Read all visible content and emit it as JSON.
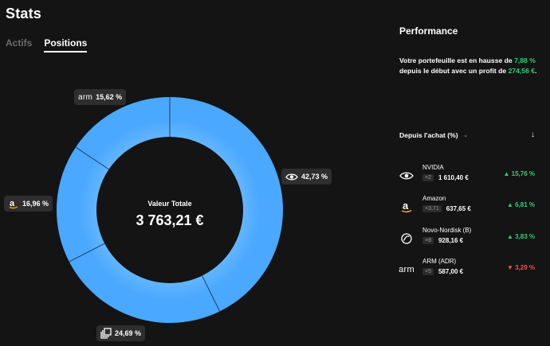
{
  "header": {
    "title": "Stats"
  },
  "tabs": [
    {
      "label": "Actifs",
      "active": false
    },
    {
      "label": "Positions",
      "active": true
    }
  ],
  "donut": {
    "center_label": "Valeur Totale",
    "center_value": "3 763,21 €",
    "segment_color": "#4aa8ff",
    "segments": [
      {
        "name": "NVIDIA",
        "value": 42.73,
        "label": "42,73 %",
        "icon": "nvidia-logo-icon"
      },
      {
        "name": "Novo-Nordisk",
        "value": 24.69,
        "label": "24,69 %",
        "icon": "stack-icon"
      },
      {
        "name": "Amazon",
        "value": 16.96,
        "label": "16,96 %",
        "icon": "amazon-logo-icon"
      },
      {
        "name": "ARM",
        "value": 15.62,
        "label": "15,62 %",
        "icon": "arm-logo-icon",
        "logo_text": "arm"
      }
    ]
  },
  "performance": {
    "title": "Performance",
    "text_before": "Votre portefeuille est en hausse de ",
    "percent": "7,88 %",
    "text_middle": " depuis le début avec un profit de ",
    "profit": "274,56 €",
    "text_after": "."
  },
  "sort": {
    "label": "Depuis l'achat (%)",
    "chevron": "⌄",
    "arrow": "↓"
  },
  "positions": [
    {
      "name": "NVIDIA",
      "qty": "×2",
      "value": "1 610,40 €",
      "change": "▲ 15,76 %",
      "trend": "up",
      "icon": "nvidia-logo-icon"
    },
    {
      "name": "Amazon",
      "qty": "×3,71",
      "value": "637,65 €",
      "change": "▲ 6,81 %",
      "trend": "up",
      "icon": "amazon-logo-icon"
    },
    {
      "name": "Novo-Nordisk (B)",
      "qty": "×8",
      "value": "928,16 €",
      "change": "▲ 3,83 %",
      "trend": "up",
      "icon": "novo-nordisk-logo-icon"
    },
    {
      "name": "ARM (ADR)",
      "qty": "×5",
      "value": "587,00 €",
      "change": "▼ 3,29 %",
      "trend": "down",
      "icon": "arm-logo-icon",
      "logo_text": "arm"
    }
  ],
  "colors": {
    "up": "#2fd07a",
    "down": "#f0545a",
    "accent": "#4aa8ff",
    "background": "#141414"
  }
}
